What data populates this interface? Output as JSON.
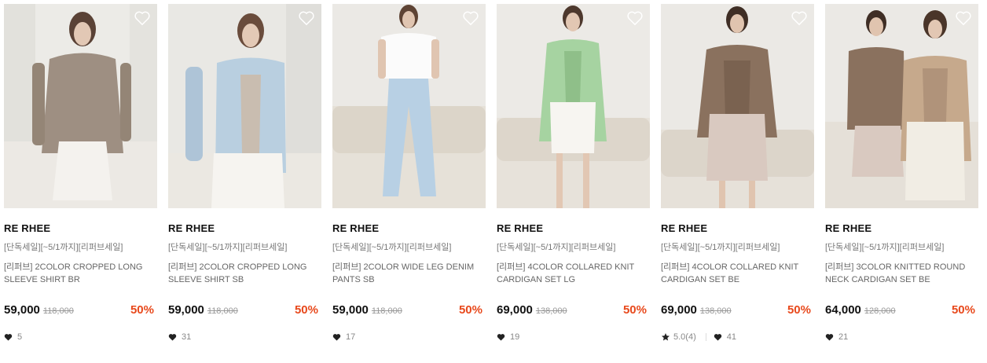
{
  "products": [
    {
      "brand": "RE RHEE",
      "promo": "[단독세일][~5/1까지][리퍼브세일]",
      "title": "[리퍼브] 2COLOR CROPPED LONG SLEEVE SHIRT BR",
      "price": "59,000",
      "original_price": "118,000",
      "discount": "50%",
      "likes": "5",
      "rating": ""
    },
    {
      "brand": "RE RHEE",
      "promo": "[단독세일][~5/1까지][리퍼브세일]",
      "title": "[리퍼브] 2COLOR CROPPED LONG SLEEVE SHIRT SB",
      "price": "59,000",
      "original_price": "118,000",
      "discount": "50%",
      "likes": "31",
      "rating": ""
    },
    {
      "brand": "RE RHEE",
      "promo": "[단독세일][~5/1까지][리퍼브세일]",
      "title": "[리퍼브] 2COLOR WIDE LEG DENIM PANTS SB",
      "price": "59,000",
      "original_price": "118,000",
      "discount": "50%",
      "likes": "17",
      "rating": ""
    },
    {
      "brand": "RE RHEE",
      "promo": "[단독세일][~5/1까지][리퍼브세일]",
      "title": "[리퍼브] 4COLOR COLLARED KNIT CARDIGAN SET LG",
      "price": "69,000",
      "original_price": "138,000",
      "discount": "50%",
      "likes": "19",
      "rating": ""
    },
    {
      "brand": "RE RHEE",
      "promo": "[단독세일][~5/1까지][리퍼브세일]",
      "title": "[리퍼브] 4COLOR COLLARED KNIT CARDIGAN SET BE",
      "price": "69,000",
      "original_price": "138,000",
      "discount": "50%",
      "likes": "41",
      "rating": "5.0(4)"
    },
    {
      "brand": "RE RHEE",
      "promo": "[단독세일][~5/1까지][리퍼브세일]",
      "title": "[리퍼브] 3COLOR KNITTED ROUND NECK CARDIGAN SET BE",
      "price": "64,000",
      "original_price": "128,000",
      "discount": "50%",
      "likes": "21",
      "rating": ""
    }
  ],
  "colors": {
    "discount": "#e8491c",
    "photo_bg": "#ebe8e3"
  },
  "icons": {
    "wishlist": "heart-outline-icon",
    "likes": "heart-filled-icon",
    "rating": "star-icon"
  }
}
